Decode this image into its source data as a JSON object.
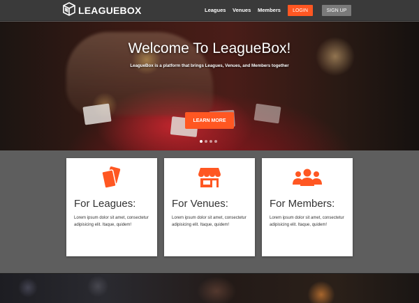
{
  "brand": {
    "name": "LEAGUEBOX",
    "logo_icon": "cube-logo-icon"
  },
  "nav": {
    "links": [
      "Leagues",
      "Venues",
      "Members"
    ],
    "login_label": "LOGIN",
    "signup_label": "SIGN UP",
    "accent_color": "#ff5722"
  },
  "hero": {
    "title": "Welcome To LeagueBox!",
    "subtitle": "LeagueBox is a platform that brings Leagues, Venues, and Members together",
    "cta_label": "LEARN MORE",
    "slides": {
      "count": 4,
      "active": 1
    }
  },
  "features": [
    {
      "icon": "playing-cards-icon",
      "title": "For Leagues:",
      "text": "Lorem ipsum dolor sit amet, consectetur adipisicing elit. Itaque, quidem!"
    },
    {
      "icon": "storefront-icon",
      "title": "For Venues:",
      "text": "Lorem ipsum dolor sit amet, consectetur adipisicing elit. Itaque, quidem!"
    },
    {
      "icon": "people-group-icon",
      "title": "For Members:",
      "text": "Lorem ipsum dolor sit amet, consectetur adipisicing elit. Itaque, quidem!"
    }
  ]
}
